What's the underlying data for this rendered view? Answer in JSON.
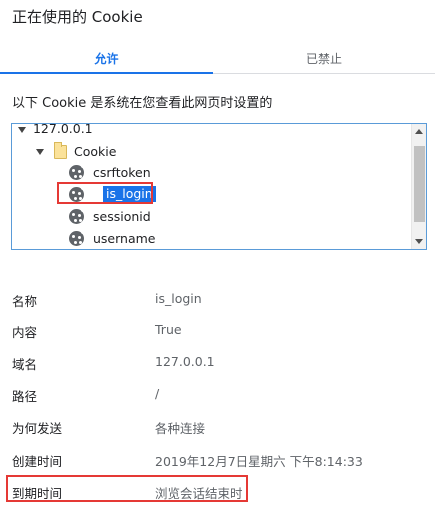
{
  "dialog": {
    "title": "正在使用的 Cookie"
  },
  "tabs": [
    {
      "label": "允许",
      "active": true
    },
    {
      "label": "已禁止",
      "active": false
    }
  ],
  "description": "以下 Cookie 是系统在您查看此网页时设置的",
  "tree": {
    "host": "127.0.0.1",
    "folder": "Cookie",
    "cookies": [
      "csrftoken",
      "is_login",
      "sessionid",
      "username"
    ],
    "selected": "is_login"
  },
  "details": [
    {
      "label": "名称",
      "value": "is_login"
    },
    {
      "label": "内容",
      "value": "True"
    },
    {
      "label": "域名",
      "value": "127.0.0.1"
    },
    {
      "label": "路径",
      "value": "/"
    },
    {
      "label": "为何发送",
      "value": "各种连接"
    },
    {
      "label": "创建时间",
      "value": "2019年12月7日星期六 下午8:14:33"
    },
    {
      "label": "到期时间",
      "value": "浏览会话结束时"
    }
  ],
  "colors": {
    "accent": "#1a73e8",
    "highlight_box": "#e53935",
    "tree_border": "#5a9bd8"
  }
}
